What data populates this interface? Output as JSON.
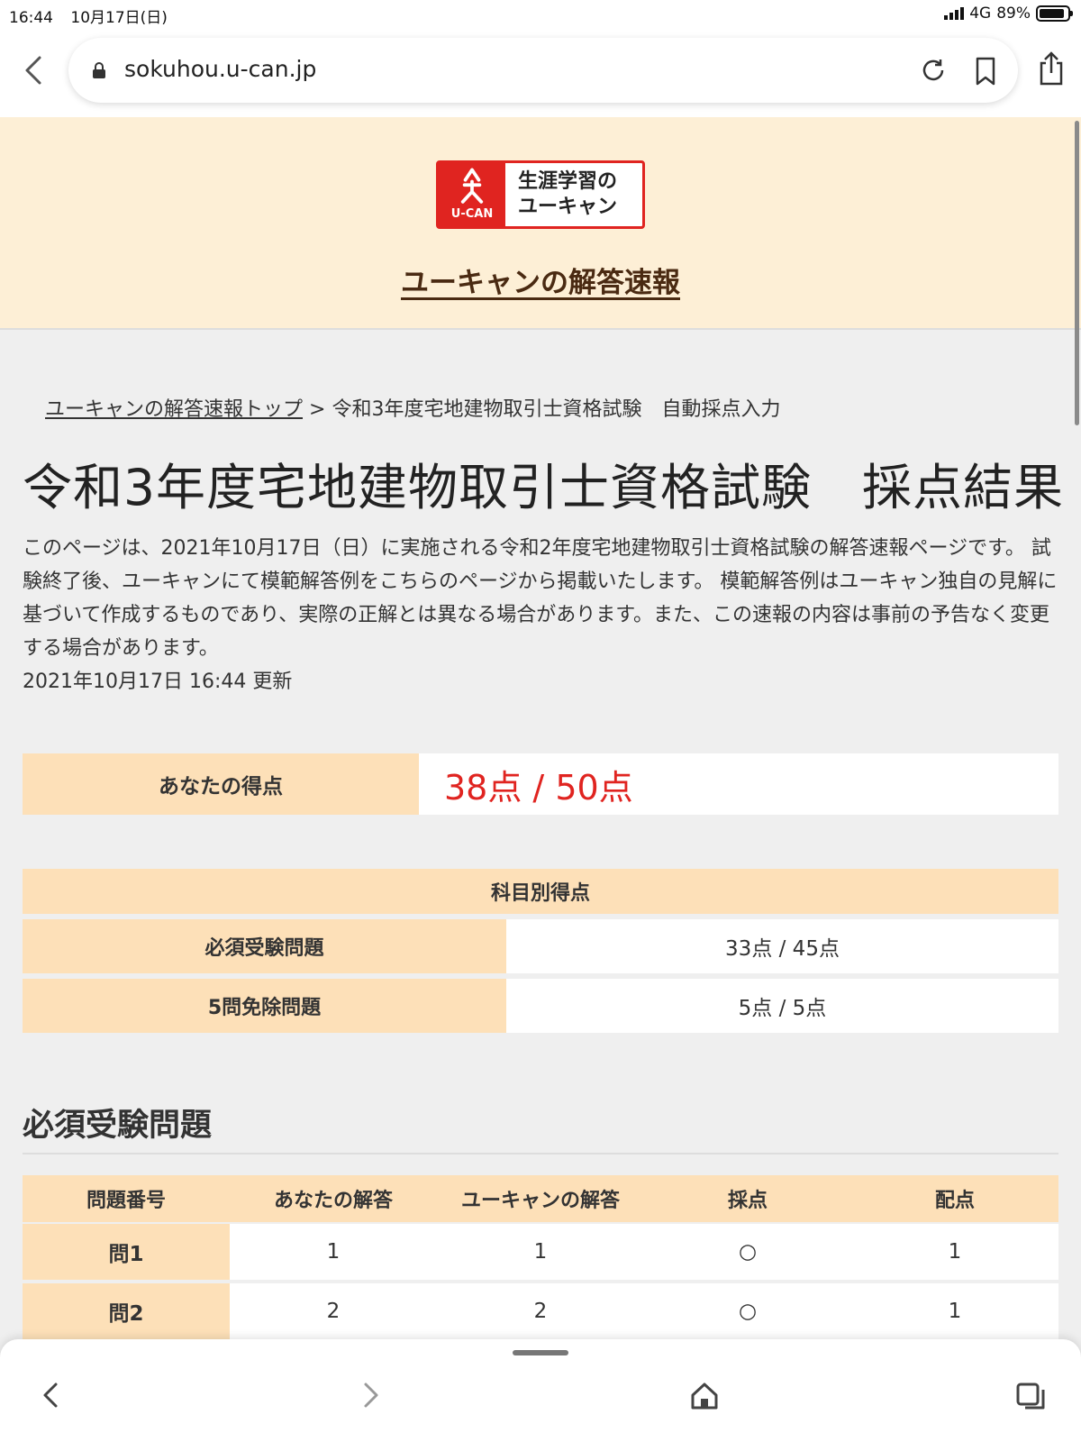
{
  "status_bar": {
    "time": "16:44",
    "date": "10月17日(日)",
    "network": "4G",
    "battery": "89%",
    "battery_level": 0.89
  },
  "browser": {
    "url": "sokuhou.u-can.jp"
  },
  "header": {
    "logo_text_line1": "生涯学習の",
    "logo_text_line2": "ユーキャン",
    "logo_mark_text": "U-CAN",
    "site_title": "ユーキャンの解答速報"
  },
  "breadcrumb": {
    "top_link": "ユーキャンの解答速報トップ",
    "separator": ">",
    "current": "令和3年度宅地建物取引士資格試験　自動採点入力"
  },
  "page_title": "令和3年度宅地建物取引士資格試験　採点結果",
  "intro": {
    "text": "このページは、2021年10月17日（日）に実施される令和2年度宅地建物取引士資格試験の解答速報ページです。 試験終了後、ユーキャンにて模範解答例をこちらのページから掲載いたします。 模範解答例はユーキャン独自の見解に基づいて作成するものであり、実際の正解とは異なる場合があります。また、この速報の内容は事前の予告なく変更する場合があります。",
    "updated": "2021年10月17日 16:44 更新"
  },
  "score": {
    "label": "あなたの得点",
    "value": "38点 / 50点"
  },
  "subject_scores": {
    "heading": "科目別得点",
    "rows": [
      {
        "name": "必須受験問題",
        "score": "33点 / 45点"
      },
      {
        "name": "5問免除問題",
        "score": "5点 / 5点"
      }
    ]
  },
  "required_section": {
    "title": "必須受験問題",
    "columns": [
      "問題番号",
      "あなたの解答",
      "ユーキャンの解答",
      "採点",
      "配点"
    ],
    "rows": [
      {
        "number": "問1",
        "your_answer": "1",
        "ucan_answer": "1",
        "grade": "○",
        "points": "1"
      },
      {
        "number": "問2",
        "your_answer": "2",
        "ucan_answer": "2",
        "grade": "○",
        "points": "1"
      }
    ]
  },
  "colors": {
    "accent_red": "#e02420",
    "header_bg": "#fdefd6",
    "cell_orange": "#fde0b8"
  }
}
